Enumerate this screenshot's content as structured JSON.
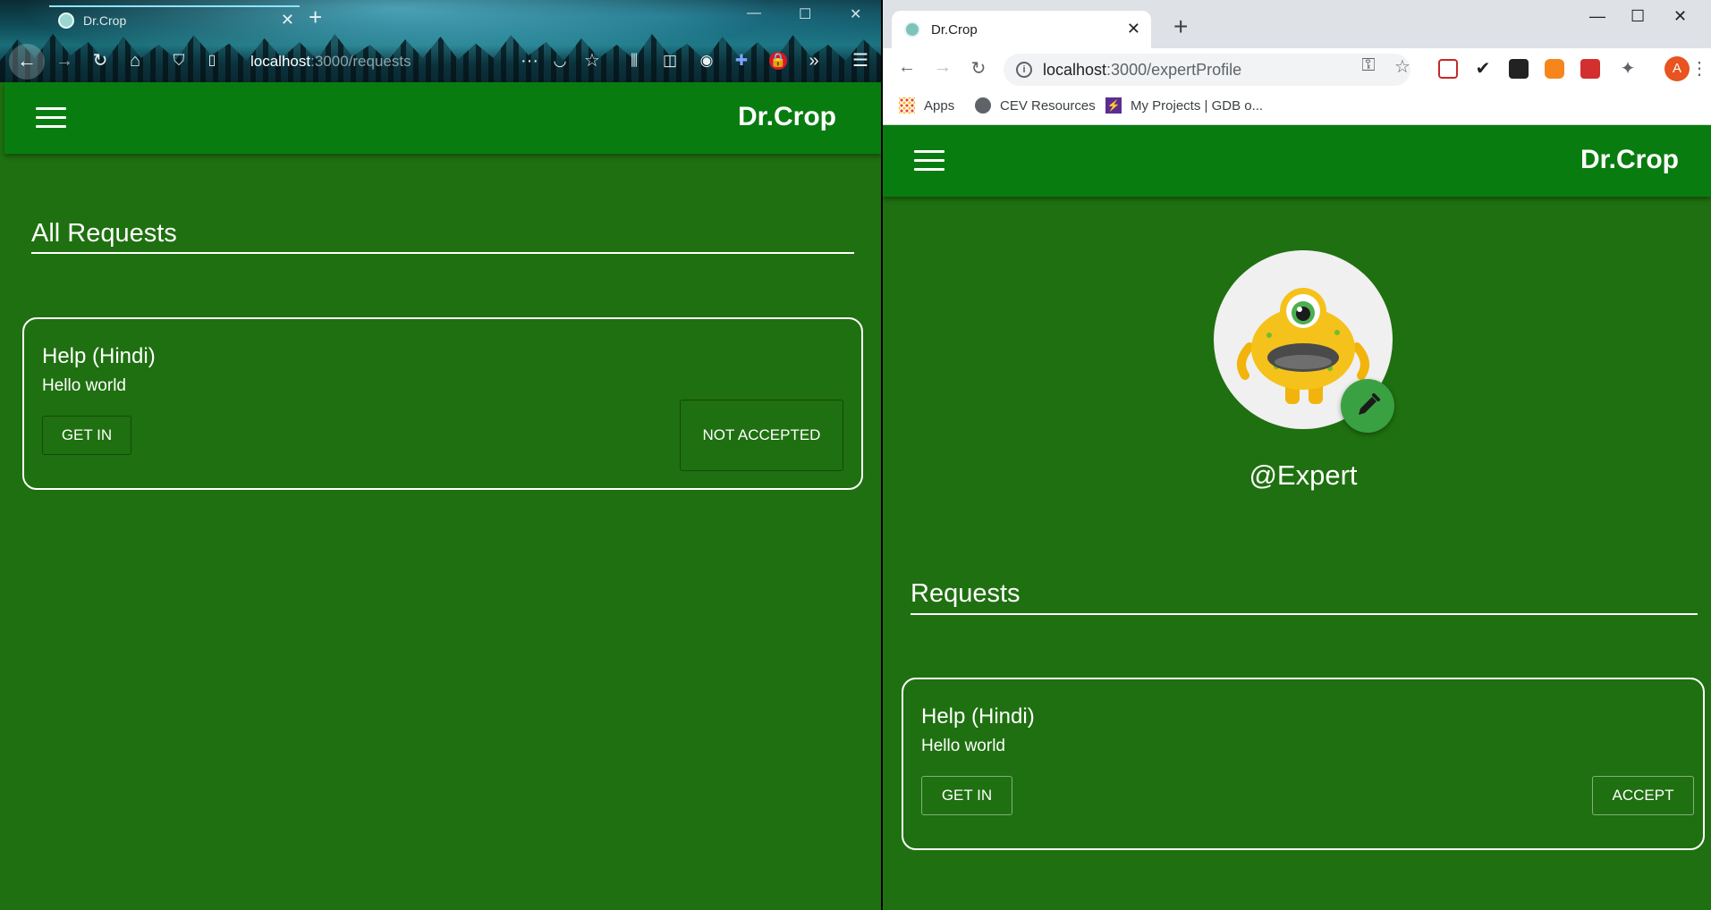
{
  "left_window": {
    "tab_title": "Dr.Crop",
    "url_host": "localhost",
    "url_path": ":3000/requests",
    "brand": "Dr.Crop",
    "section_title": "All Requests",
    "requests": [
      {
        "title": "Help (Hindi)",
        "message": "Hello world",
        "get_in_label": "GET IN",
        "status_label": "NOT ACCEPTED"
      }
    ]
  },
  "right_window": {
    "tab_title": "Dr.Crop",
    "url_host": "localhost",
    "url_path": ":3000/expertProfile",
    "bookmarks": [
      {
        "label": "Apps",
        "icon": "apps-grid-icon"
      },
      {
        "label": "CEV Resources",
        "icon": "globe-icon"
      },
      {
        "label": "My Projects | GDB o...",
        "icon": "gdb-lightning-icon"
      }
    ],
    "profile_avatar_initial": "A",
    "brand": "Dr.Crop",
    "username": "@Expert",
    "section_title": "Requests",
    "requests": [
      {
        "title": "Help (Hindi)",
        "message": "Hello world",
        "get_in_label": "GET IN",
        "accept_label": "ACCEPT"
      }
    ]
  },
  "colors": {
    "page_green": "#1f7010",
    "header_green": "#097c10",
    "fab_green": "#3aa142"
  }
}
